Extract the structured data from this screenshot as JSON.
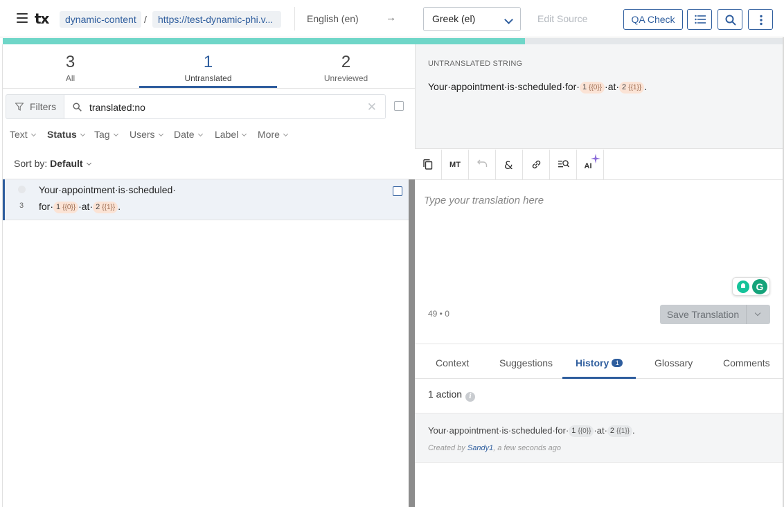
{
  "header": {
    "logo": "tx",
    "project": "dynamic-content",
    "separator": "/",
    "resource": "https://test-dynamic-phi.v...",
    "source_language": "English (en)",
    "arrow": "→",
    "target_language": "Greek (el)",
    "edit_source": "Edit Source",
    "qa_check": "QA Check"
  },
  "progress": {
    "translated_fraction": 0.67
  },
  "tabs": [
    {
      "count": "3",
      "label": "All"
    },
    {
      "count": "1",
      "label": "Untranslated"
    },
    {
      "count": "2",
      "label": "Unreviewed"
    }
  ],
  "filters": {
    "button": "Filters",
    "search_value": "translated:no",
    "clear": "✕",
    "facets": [
      "Text",
      "Status",
      "Tag",
      "Users",
      "Date",
      "Label",
      "More"
    ]
  },
  "sort": {
    "label": "Sort by:",
    "value": "Default"
  },
  "string_list": [
    {
      "index": "3",
      "line1": "Your·appointment·is·scheduled·",
      "line2_prefix": "for·",
      "ph1_num": "1",
      "ph1": "{{0}}",
      "mid": "·at·",
      "ph2_num": "2",
      "ph2": "{{1}}",
      "suffix": "."
    }
  ],
  "source": {
    "label": "UNTRANSLATED STRING",
    "prefix": "Your·appointment·is·scheduled·for·",
    "ph1_num": "1",
    "ph1": "{{0}}",
    "mid": "·at·",
    "ph2_num": "2",
    "ph2": "{{1}}",
    "suffix": "."
  },
  "toolbar": {
    "mt": "MT",
    "ai": "AI"
  },
  "editor": {
    "placeholder": "Type your translation here",
    "char_count": "49 • 0",
    "save": "Save Translation"
  },
  "bottom_tabs": {
    "context": "Context",
    "suggestions": "Suggestions",
    "history": "History",
    "history_badge": "1",
    "glossary": "Glossary",
    "comments": "Comments"
  },
  "history": {
    "actions": "1 action",
    "info": "i",
    "prefix": "Your·appointment·is·scheduled·for·",
    "ph1_num": "1",
    "ph1": "{{0}}",
    "mid": "·at·",
    "ph2_num": "2",
    "ph2": "{{1}}",
    "suffix": ".",
    "created_by": "Created by ",
    "user": "Sandy1",
    "time": ", a few seconds ago"
  },
  "colors": {
    "accent": "#2f5e9e",
    "progress": "#6fd6c8",
    "placeholder_chip": "#fbe3d5"
  }
}
